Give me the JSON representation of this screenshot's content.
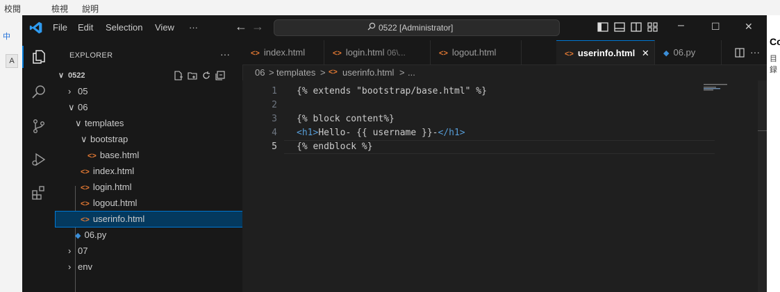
{
  "background_app": {
    "menu": [
      "校閱",
      "檢視",
      "說明"
    ],
    "ime_label": "中",
    "ime_box": "A",
    "right_text_1": "Co",
    "right_text_2": "目録"
  },
  "titlebar": {
    "menu": [
      "File",
      "Edit",
      "Selection",
      "View",
      "···"
    ],
    "search_text": "0522 [Administrator]",
    "window_controls": {
      "minimize": "–",
      "restore": "☐",
      "close": "✕"
    }
  },
  "explorer": {
    "header": "EXPLORER",
    "more": "···",
    "root": "0522",
    "items": [
      {
        "label": "05",
        "type": "folder",
        "expanded": false,
        "depth": 1
      },
      {
        "label": "06",
        "type": "folder",
        "expanded": true,
        "depth": 1
      },
      {
        "label": "templates",
        "type": "folder",
        "expanded": true,
        "depth": 2
      },
      {
        "label": "bootstrap",
        "type": "folder",
        "expanded": true,
        "depth": 3
      },
      {
        "label": "base.html",
        "type": "html",
        "depth": 4
      },
      {
        "label": "index.html",
        "type": "html",
        "depth": 3
      },
      {
        "label": "login.html",
        "type": "html",
        "depth": 3
      },
      {
        "label": "logout.html",
        "type": "html",
        "depth": 3
      },
      {
        "label": "userinfo.html",
        "type": "html",
        "depth": 3,
        "selected": true
      },
      {
        "label": "06.py",
        "type": "py",
        "depth": 2
      },
      {
        "label": "07",
        "type": "folder",
        "expanded": false,
        "depth": 1
      },
      {
        "label": "env",
        "type": "folder",
        "expanded": false,
        "depth": 1
      }
    ]
  },
  "tabs": [
    {
      "label": "index.html",
      "icon": "html"
    },
    {
      "label": "login.html",
      "hint": "06\\...",
      "icon": "html"
    },
    {
      "label": "logout.html",
      "icon": "html"
    },
    {
      "label": "userinfo.html",
      "icon": "html",
      "active": true,
      "close": "✕"
    },
    {
      "label": "06.py",
      "icon": "py"
    }
  ],
  "tab_actions": {
    "more": "···"
  },
  "breadcrumbs": [
    "06",
    ">",
    "templates",
    ">",
    "userinfo.html",
    ">",
    "..."
  ],
  "editor": {
    "line_numbers": [
      "1",
      "2",
      "3",
      "4",
      "5"
    ],
    "lines": [
      "{% extends \"bootstrap/base.html\" %}",
      "",
      "{% block content%}",
      "",
      "{% endblock %}"
    ],
    "line4": {
      "open": "<h1>",
      "text": "Hello- {{ username }}-",
      "close": "</h1>"
    }
  },
  "colors": {
    "accent": "#0078d4",
    "selection": "#04395e",
    "html_icon": "#e37933",
    "py_icon": "#3b8ed8"
  }
}
